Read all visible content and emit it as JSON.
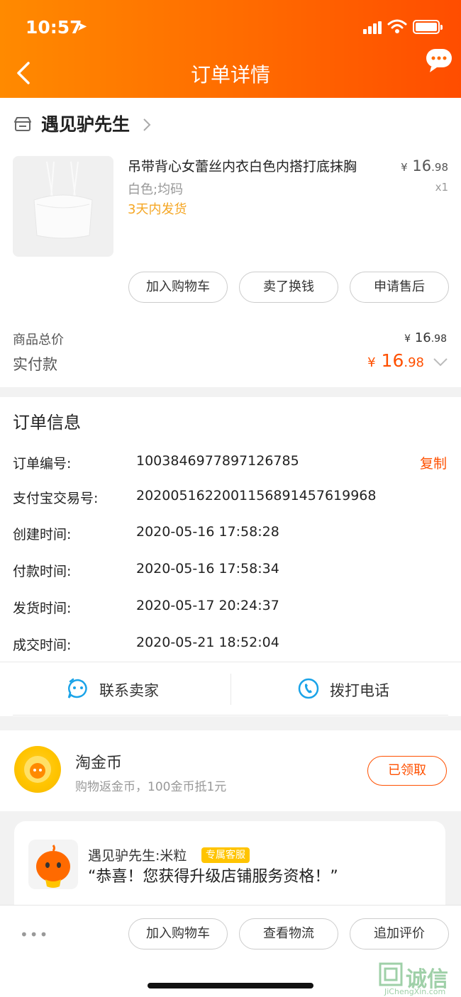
{
  "status_bar": {
    "time": "10:57"
  },
  "header": {
    "title": "订单详情"
  },
  "shop": {
    "name": "遇见驴先生"
  },
  "product": {
    "name": "吊带背心女蕾丝内衣白色内搭打底抹胸",
    "spec": "白色;均码",
    "shipping": "3天内发货",
    "price_currency": "¥",
    "price_int": "16",
    "price_dec": ".98",
    "qty": "x1"
  },
  "actions": {
    "add_cart": "加入购物车",
    "resell": "卖了换钱",
    "after_sale": "申请售后"
  },
  "totals": {
    "goods_label": "商品总价",
    "goods_currency": "¥",
    "goods_int": "16",
    "goods_dec": ".98",
    "paid_label": "实付款",
    "paid_currency": "¥",
    "paid_int": "16",
    "paid_dec": ".98"
  },
  "order_info": {
    "title": "订单信息",
    "copy_label": "复制",
    "rows": [
      {
        "label": "订单编号:",
        "value": "1003846977897126785"
      },
      {
        "label": "支付宝交易号:",
        "value": "2020051622001156891457619968"
      },
      {
        "label": "创建时间:",
        "value": "2020-05-16 17:58:28"
      },
      {
        "label": "付款时间:",
        "value": "2020-05-16 17:58:34"
      },
      {
        "label": "发货时间:",
        "value": "2020-05-17 20:24:37"
      },
      {
        "label": "成交时间:",
        "value": "2020-05-21 18:52:04"
      }
    ]
  },
  "contact": {
    "seller": "联系卖家",
    "call": "拨打电话"
  },
  "coins": {
    "title": "淘金币",
    "subtitle": "购物返金币，100金币抵1元",
    "button": "已领取"
  },
  "service": {
    "name": "遇见驴先生:米粒",
    "badge": "专属客服",
    "message": "“恭喜！您获得升级店铺服务资格！”"
  },
  "bottom_bar": {
    "more": "•••",
    "add_cart": "加入购物车",
    "logistics": "查看物流",
    "review": "追加评价"
  },
  "watermark": {
    "brand": "诚信",
    "site": "JiChengXin.com"
  },
  "colors": {
    "accent": "#ff5000",
    "header_start": "#ff8a00",
    "header_end": "#ff4d00",
    "shipping": "#f5a623"
  }
}
